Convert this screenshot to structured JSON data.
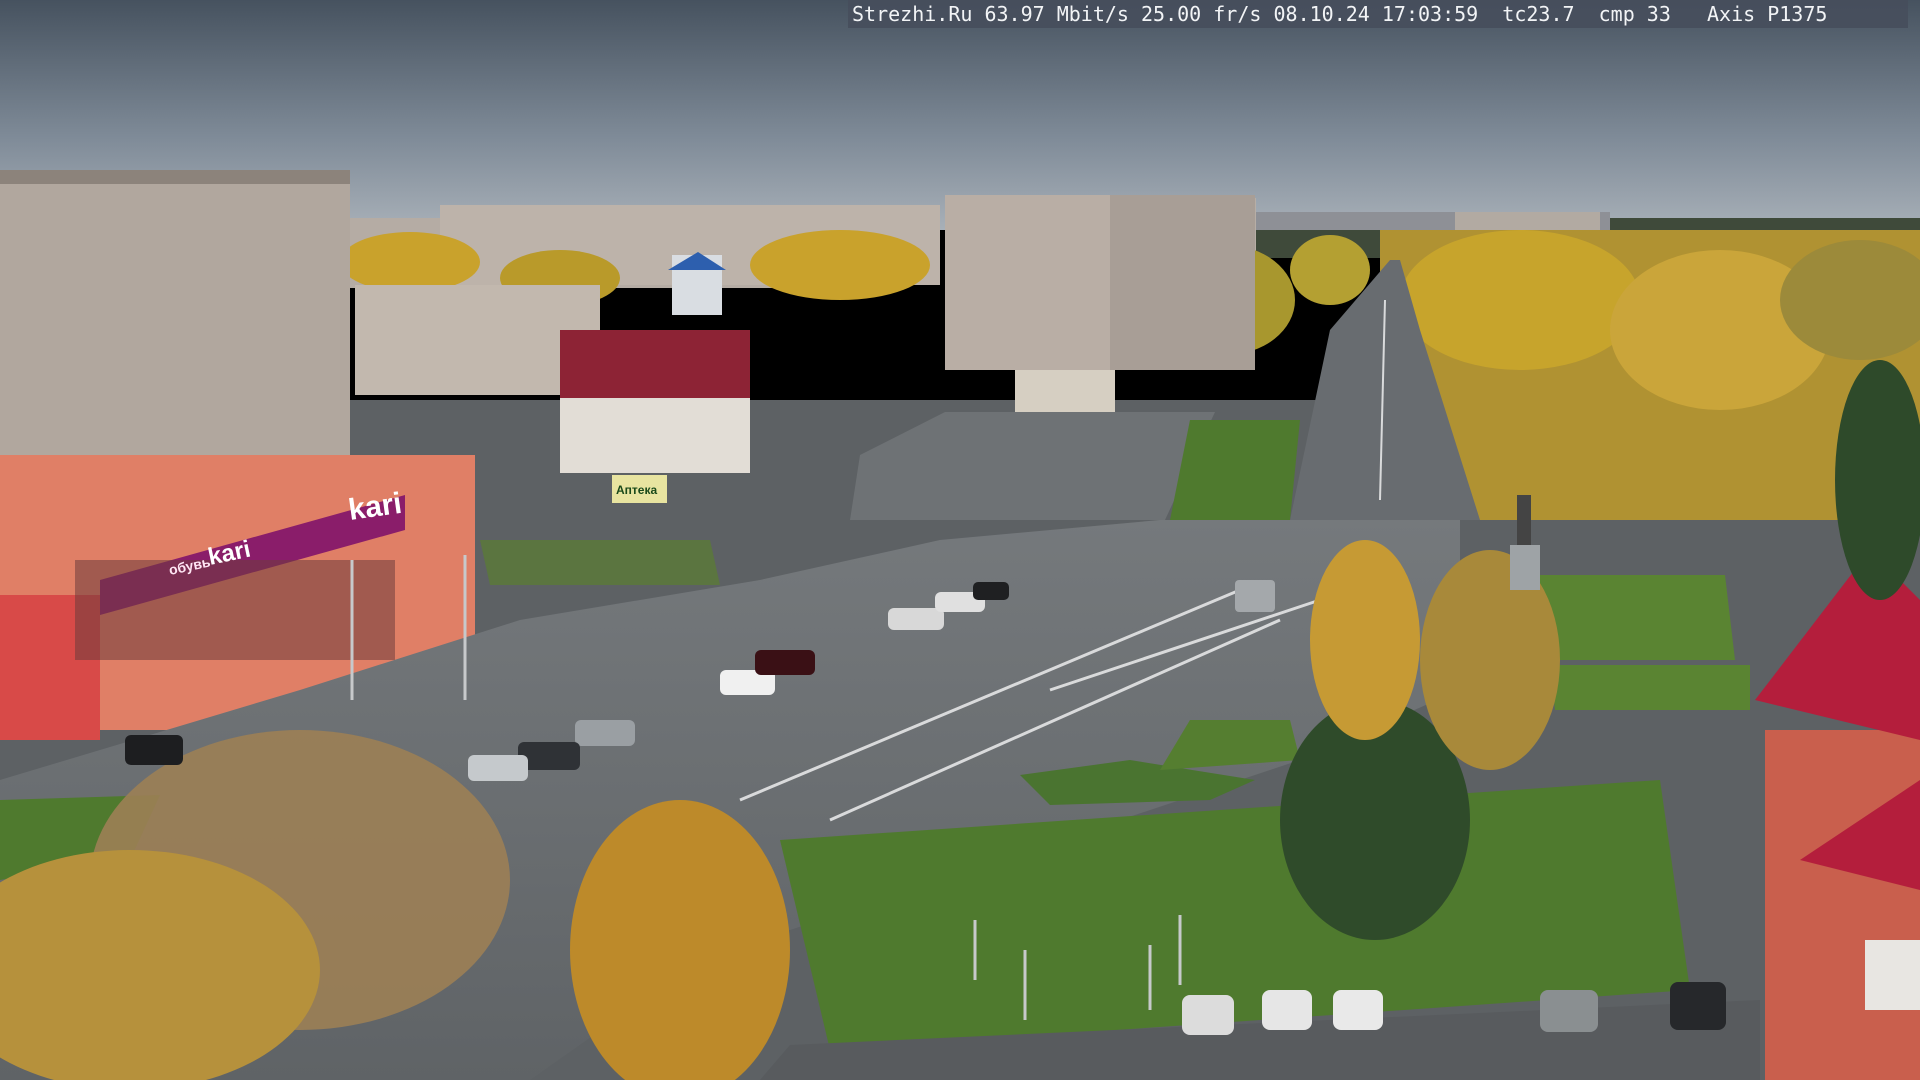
{
  "overlay": {
    "site": "Strezhi.Ru",
    "bitrate": "63.97 Mbit/s",
    "fps": "25.00 fr/s",
    "date": "08.10.24",
    "time": "17:03:59",
    "tc": "tc23.7",
    "cmp": "cmp 33",
    "camera": "Axis P1375"
  },
  "signs": {
    "store_big": "kari",
    "store_small": "kari",
    "store_sub": "обувь",
    "pharmacy": "Аптека"
  },
  "colors": {
    "sky_top": "#4a5868",
    "sky_bottom": "#9aa6b2",
    "asphalt": "#6b6f73",
    "grass": "#4f7a2e",
    "autumn_yellow": "#c9a22c",
    "brick_red": "#b43a3a",
    "store_magenta": "#8a1d6a"
  }
}
